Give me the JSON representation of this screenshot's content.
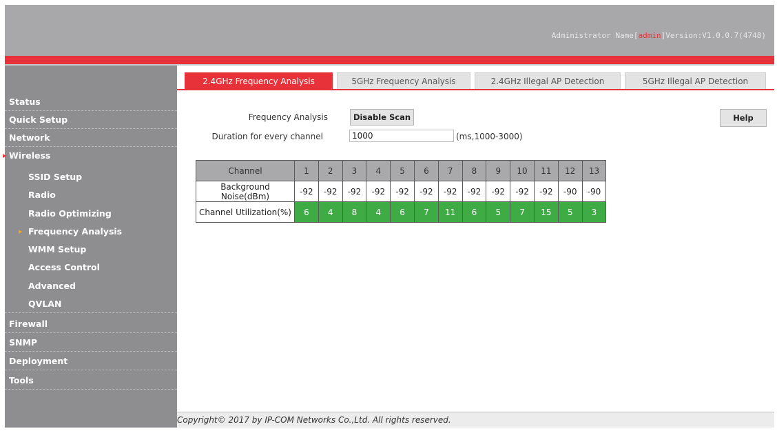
{
  "header": {
    "admin_label": "Administrator Name",
    "admin_name": "admin",
    "version": "Version:V1.0.0.7(4748)"
  },
  "sidebar": {
    "items": [
      {
        "label": "Status"
      },
      {
        "label": "Quick Setup"
      },
      {
        "label": "Network"
      },
      {
        "label": "Wireless"
      }
    ],
    "wireless_sub": [
      {
        "label": "SSID Setup"
      },
      {
        "label": "Radio"
      },
      {
        "label": "Radio Optimizing"
      },
      {
        "label": "Frequency Analysis"
      },
      {
        "label": "WMM Setup"
      },
      {
        "label": "Access Control"
      },
      {
        "label": "Advanced"
      },
      {
        "label": "QVLAN"
      }
    ],
    "lower_items": [
      {
        "label": "Firewall"
      },
      {
        "label": "SNMP"
      },
      {
        "label": "Deployment"
      },
      {
        "label": "Tools"
      }
    ]
  },
  "tabs": [
    {
      "label": "2.4GHz Frequency Analysis"
    },
    {
      "label": "5GHz Frequency Analysis"
    },
    {
      "label": "2.4GHz Illegal AP Detection"
    },
    {
      "label": "5GHz Illegal AP Detection"
    }
  ],
  "form": {
    "freq_label": "Frequency Analysis",
    "scan_button": "Disable Scan",
    "duration_label": "Duration for every channel",
    "duration_value": "1000",
    "duration_hint": "(ms,1000-3000)",
    "help_button": "Help"
  },
  "table": {
    "channel_label": "Channel",
    "noise_label": "Background Noise(dBm)",
    "util_label": "Channel Utilization(%)",
    "channels": [
      "1",
      "2",
      "3",
      "4",
      "5",
      "6",
      "7",
      "8",
      "9",
      "10",
      "11",
      "12",
      "13"
    ],
    "noise": [
      "-92",
      "-92",
      "-92",
      "-92",
      "-92",
      "-92",
      "-92",
      "-92",
      "-92",
      "-92",
      "-92",
      "-90",
      "-90"
    ],
    "utilization": [
      "6",
      "4",
      "8",
      "4",
      "6",
      "7",
      "11",
      "6",
      "5",
      "7",
      "15",
      "5",
      "3"
    ]
  },
  "footer": {
    "copyright": "Copyright© 2017 by IP-COM Networks Co.,Ltd. All rights reserved."
  },
  "colors": {
    "accent_red": "#e8323a",
    "utilization_green": "#3fab45",
    "sidebar_gray": "#8e8e90"
  }
}
